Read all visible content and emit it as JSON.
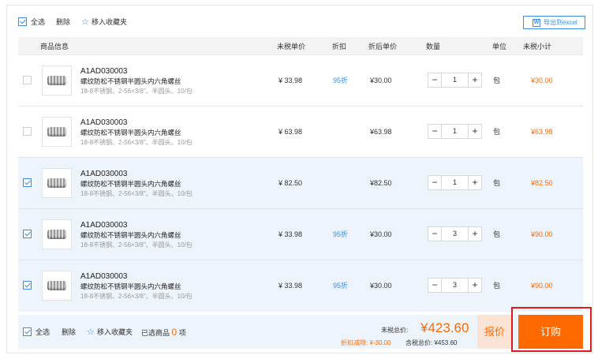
{
  "toolbar": {
    "select_all_label": "全选",
    "delete_label": "删除",
    "move_fav_label": "移入收藏夹",
    "export_label": "导出到excel"
  },
  "columns": [
    "商品信息",
    "未税单价",
    "折扣",
    "折后单价",
    "数量",
    "单位",
    "未税小计"
  ],
  "rows": [
    {
      "checked": false,
      "code": "A1AD030003",
      "name": "螺纹防松不锈钢半圆头内六角螺丝",
      "spec": "18-8不锈钢、2-56×3/8\"、半圆头、10/包",
      "unit_price": "¥ 33.98",
      "discount": "95折",
      "discounted_price": "¥30.00",
      "qty": "1",
      "unit": "包",
      "subtotal": "¥30.00"
    },
    {
      "checked": false,
      "code": "A1AD030003",
      "name": "螺纹防松不锈钢半圆头内六角螺丝",
      "spec": "18-8不锈钢、2-56×3/8\"、半圆头、10/包",
      "unit_price": "¥ 63.98",
      "discount": "",
      "discounted_price": "¥63.98",
      "qty": "1",
      "unit": "包",
      "subtotal": "¥63.98"
    },
    {
      "checked": true,
      "code": "A1AD030003",
      "name": "螺纹防松不锈钢半圆头内六角螺丝",
      "spec": "18-8不锈钢、2-56×3/8\"、半圆头、10/包",
      "unit_price": "¥ 82.50",
      "discount": "",
      "discounted_price": "¥82.50",
      "qty": "1",
      "unit": "包",
      "subtotal": "¥82.50"
    },
    {
      "checked": true,
      "code": "A1AD030003",
      "name": "螺纹防松不锈钢半圆头内六角螺丝",
      "spec": "18-8不锈钢、2-56×3/8\"、半圆头、10/包",
      "unit_price": "¥ 33.98",
      "discount": "95折",
      "discounted_price": "¥30.00",
      "qty": "3",
      "unit": "包",
      "subtotal": "¥90.00"
    },
    {
      "checked": true,
      "code": "A1AD030003",
      "name": "螺纹防松不锈钢半圆头内六角螺丝",
      "spec": "18-8不锈钢、2-56×3/8\"、半圆头、10/包",
      "unit_price": "¥ 33.98",
      "discount": "95折",
      "discounted_price": "¥30.00",
      "qty": "3",
      "unit": "包",
      "subtotal": "¥90.00"
    }
  ],
  "stepper": {
    "minus": "−",
    "plus": "+"
  },
  "footer": {
    "select_all_label": "全选",
    "delete_label": "删除",
    "move_fav_label": "移入收藏夹",
    "selected_prefix": "已选商品",
    "selected_count": "0",
    "selected_suffix": "项",
    "total_label": "未税总价:",
    "total_value": "¥423.60",
    "discount_label": "折扣减除: ¥-30.00",
    "tax_incl_label": "含税总价: ¥453.60",
    "quote_label": "报价",
    "order_label": "订购"
  },
  "colors": {
    "accent": "#3a8ee6",
    "orange": "#ff6a00",
    "highlight": "#e01b1b"
  }
}
